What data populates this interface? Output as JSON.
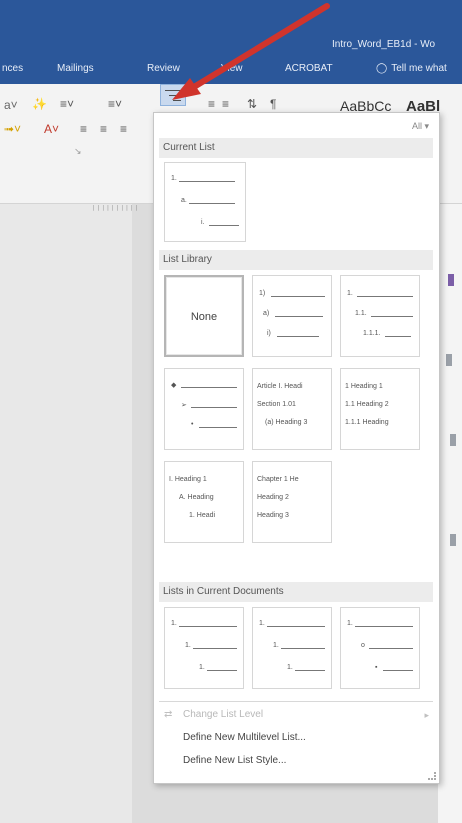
{
  "window": {
    "title": "Intro_Word_EB1d - Wo"
  },
  "tabs": [
    {
      "id": "references",
      "label": "nces"
    },
    {
      "id": "mailings",
      "label": "Mailings"
    },
    {
      "id": "review",
      "label": "Review"
    },
    {
      "id": "view",
      "label": "View"
    },
    {
      "id": "acrobat",
      "label": "ACROBAT"
    }
  ],
  "tell_me": "Tell me what",
  "ribbon": {
    "style_preview_1": "AaBbCc",
    "style_preview_2": "AaBl"
  },
  "dropdown": {
    "filter": "All ▾",
    "current_list": {
      "title": "Current List",
      "tile": [
        {
          "label": "1."
        },
        {
          "label": "a."
        },
        {
          "label": "i."
        }
      ]
    },
    "list_library": {
      "title": "List Library",
      "tiles": [
        {
          "id": "none",
          "text": "None"
        },
        {
          "id": "num-paren",
          "rows": [
            {
              "label": "1)"
            },
            {
              "label": "a)"
            },
            {
              "label": "i)"
            }
          ]
        },
        {
          "id": "decimal",
          "rows": [
            {
              "label": "1."
            },
            {
              "label": "1.1."
            },
            {
              "label": "1.1.1."
            }
          ]
        },
        {
          "id": "bullets",
          "rows": [
            {
              "label": "◆"
            },
            {
              "label": "➢"
            },
            {
              "label": "•"
            }
          ]
        },
        {
          "id": "article",
          "rows": [
            {
              "label": "Article I. Headi"
            },
            {
              "label": "Section 1.01"
            },
            {
              "label": "(a) Heading 3"
            }
          ]
        },
        {
          "id": "heading-decimal",
          "rows": [
            {
              "label": "1 Heading 1"
            },
            {
              "label": "1.1 Heading 2"
            },
            {
              "label": "1.1.1 Heading"
            }
          ]
        },
        {
          "id": "heading-roman",
          "rows": [
            {
              "label": "I. Heading 1"
            },
            {
              "label": "A. Heading"
            },
            {
              "label": "1. Headi"
            }
          ]
        },
        {
          "id": "chapter",
          "rows": [
            {
              "label": "Chapter 1 He"
            },
            {
              "label": "Heading 2"
            },
            {
              "label": "Heading 3"
            }
          ]
        }
      ]
    },
    "lists_in_doc": {
      "title": "Lists in Current Documents",
      "tiles": [
        {
          "rows": [
            {
              "label": "1."
            },
            {
              "label": "1."
            },
            {
              "label": "1."
            }
          ]
        },
        {
          "rows": [
            {
              "label": "1."
            },
            {
              "label": "1."
            },
            {
              "label": "1."
            }
          ]
        },
        {
          "rows": [
            {
              "label": "1."
            },
            {
              "label": "o"
            },
            {
              "label": "▪"
            }
          ]
        }
      ]
    },
    "menu": {
      "change_list_level": "Change List Level",
      "define_multilevel": "Define New Multilevel List...",
      "define_style": "Define New List Style..."
    }
  },
  "colors": {
    "ribbon_blue": "#2b579a",
    "arrow_red": "#d0342c"
  }
}
